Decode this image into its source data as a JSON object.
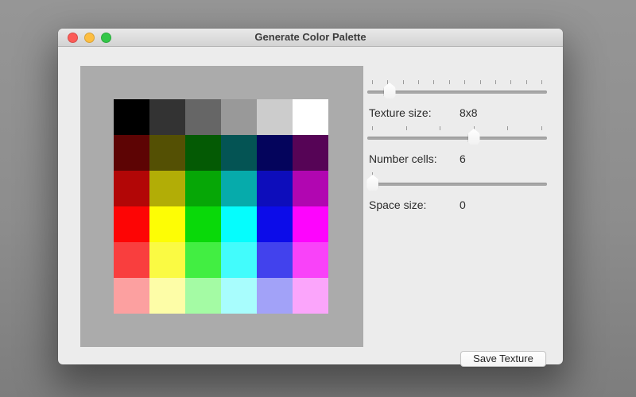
{
  "window": {
    "title": "Generate Color Palette",
    "traffic_lights": {
      "close_color": "#fc5b57",
      "minimize_color": "#fdbe41",
      "zoom_color": "#33c748"
    }
  },
  "preview": {
    "background_color": "#ababab",
    "grid": {
      "rows": 6,
      "cols": 6,
      "colors": [
        [
          "#000000",
          "#333333",
          "#666666",
          "#999999",
          "#cccccc",
          "#ffffff"
        ],
        [
          "#5d0404",
          "#545004",
          "#045a04",
          "#045454",
          "#04045c",
          "#560456"
        ],
        [
          "#b20606",
          "#b2ad06",
          "#06a706",
          "#06abab",
          "#0d0dbb",
          "#b106b1"
        ],
        [
          "#fd0505",
          "#fdfd05",
          "#09d909",
          "#05fdfd",
          "#0c0ce9",
          "#fd05fd"
        ],
        [
          "#f93e3e",
          "#fafa43",
          "#42ee42",
          "#42fcfc",
          "#4242ed",
          "#f942f9"
        ],
        [
          "#fca0a0",
          "#fdfda7",
          "#a4fba4",
          "#a8fdfd",
          "#a2a2f8",
          "#fba5fb"
        ]
      ]
    }
  },
  "controls": {
    "sliders": [
      {
        "name": "texture-size",
        "label": "Texture size:",
        "value": "8x8",
        "ticks": 12,
        "position_pct": 12.4
      },
      {
        "name": "number-cells",
        "label": "Number cells:",
        "value": "6",
        "ticks": 6,
        "position_pct": 59.3
      },
      {
        "name": "space-size",
        "label": "Space size:",
        "value": "0",
        "ticks": 1,
        "position_pct": 3.0
      }
    ],
    "save_button_label": "Save Texture"
  }
}
